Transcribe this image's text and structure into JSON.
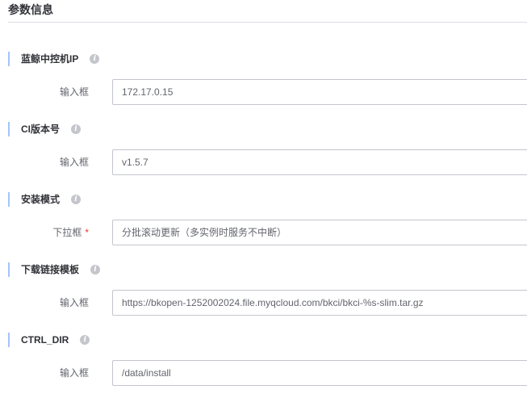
{
  "section": {
    "title": "参数信息"
  },
  "groups": [
    {
      "label": "蓝鲸中控机IP",
      "field_label": "输入框",
      "value": "172.17.0.15",
      "required": false
    },
    {
      "label": "CI版本号",
      "field_label": "输入框",
      "value": "v1.5.7",
      "required": false
    },
    {
      "label": "安装模式",
      "field_label": "下拉框",
      "value": "分批滚动更新（多实例时服务不中断）",
      "required": true
    },
    {
      "label": "下载链接模板",
      "field_label": "输入框",
      "value": "https://bkopen-1252002024.file.myqcloud.com/bkci/bkci-%s-slim.tar.gz",
      "required": false
    },
    {
      "label": "CTRL_DIR",
      "field_label": "输入框",
      "value": "/data/install",
      "required": false
    }
  ],
  "icons": {
    "info": "info-icon",
    "info_glyph": "i"
  },
  "required_mark": "*",
  "colors": {
    "accent_bar": "#a3c5fd",
    "required": "#ea3636",
    "border": "#c4c6cc"
  }
}
